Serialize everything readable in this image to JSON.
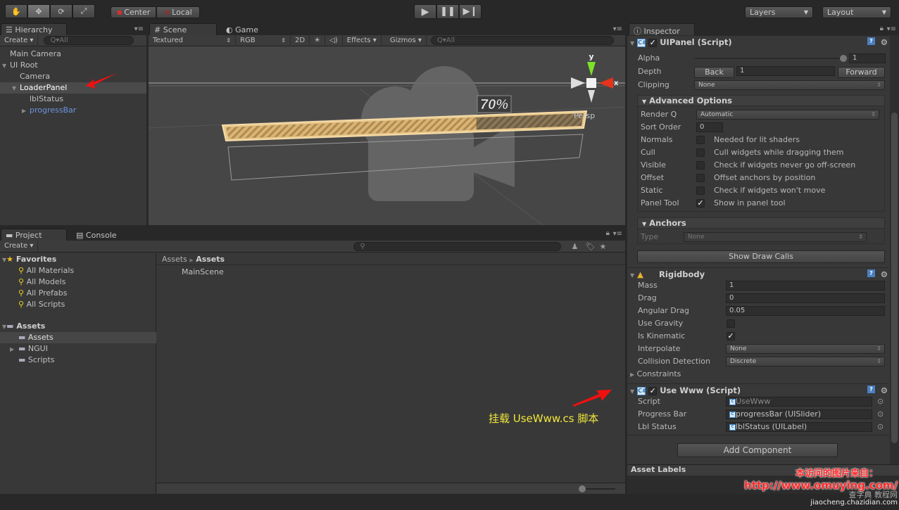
{
  "toolbar": {
    "transform_tools": [
      "hand-icon",
      "move-icon",
      "rotate-icon",
      "scale-icon"
    ],
    "pivot_label": "Center",
    "space_label": "Local",
    "play_icons": [
      "play-icon",
      "pause-icon",
      "step-icon"
    ],
    "layers_label": "Layers",
    "layout_label": "Layout"
  },
  "hierarchy": {
    "tab_label": "Hierarchy",
    "create_label": "Create",
    "search_placeholder": "Q▾All",
    "items": [
      {
        "label": "Main Camera",
        "depth": 0,
        "expander": ""
      },
      {
        "label": "UI Root",
        "depth": 0,
        "expander": "▼"
      },
      {
        "label": "Camera",
        "depth": 1,
        "expander": ""
      },
      {
        "label": "LoaderPanel",
        "depth": 1,
        "expander": "▼",
        "selected": true
      },
      {
        "label": "lblStatus",
        "depth": 2,
        "expander": ""
      },
      {
        "label": "progressBar",
        "depth": 2,
        "expander": "▶",
        "prefab": true
      }
    ]
  },
  "scene": {
    "tab_scene": "Scene",
    "tab_game": "Game",
    "render_mode": "Textured",
    "channel": "RGB",
    "mode_2d": "2D",
    "effects_label": "Effects",
    "gizmos_label": "Gizmos",
    "search_placeholder": "Q▾All",
    "progress_label": "70%",
    "progress_value": 0.7,
    "gizmo_y": "y",
    "gizmo_x": "x",
    "persp_label": "Persp"
  },
  "project": {
    "tab_project": "Project",
    "tab_console": "Console",
    "create_label": "Create",
    "favorites_label": "Favorites",
    "favorites": [
      "All Materials",
      "All Models",
      "All Prefabs",
      "All Scripts"
    ],
    "assets_label": "Assets",
    "asset_folders": [
      {
        "label": "Assets",
        "selected": true,
        "expander": ""
      },
      {
        "label": "NGUI",
        "selected": false,
        "expander": "▶"
      },
      {
        "label": "Scripts",
        "selected": false,
        "expander": ""
      }
    ],
    "breadcrumb_root": "Assets",
    "breadcrumb_current": "Assets",
    "files": [
      "MainScene"
    ]
  },
  "annotation": {
    "text": "挂载 UseWww.cs 脚本",
    "color": "#f0e63c"
  },
  "inspector": {
    "tab_label": "Inspector",
    "uipanel": {
      "title": "UIPanel (Script)",
      "enabled": true,
      "alpha_label": "Alpha",
      "alpha_value": "1",
      "depth_label": "Depth",
      "back_label": "Back",
      "depth_value": "1",
      "forward_label": "Forward",
      "clipping_label": "Clipping",
      "clipping_value": "None",
      "advanced_title": "Advanced Options",
      "render_q_label": "Render Q",
      "render_q_value": "Automatic",
      "sort_order_label": "Sort Order",
      "sort_order_value": "0",
      "options": [
        {
          "label": "Normals",
          "checked": false,
          "desc": "Needed for lit shaders"
        },
        {
          "label": "Cull",
          "checked": false,
          "desc": "Cull widgets while dragging them"
        },
        {
          "label": "Visible",
          "checked": false,
          "desc": "Check if widgets never go off-screen"
        },
        {
          "label": "Offset",
          "checked": false,
          "desc": "Offset anchors by position"
        },
        {
          "label": "Static",
          "checked": false,
          "desc": "Check if widgets won't move"
        },
        {
          "label": "Panel Tool",
          "checked": true,
          "desc": "Show in panel tool"
        }
      ],
      "anchors_title": "Anchors",
      "anchor_type_label": "Type",
      "anchor_type_value": "None",
      "show_draw_calls_label": "Show Draw Calls"
    },
    "rigidbody": {
      "title": "Rigidbody",
      "mass_label": "Mass",
      "mass_value": "1",
      "drag_label": "Drag",
      "drag_value": "0",
      "angular_drag_label": "Angular Drag",
      "angular_drag_value": "0.05",
      "use_gravity_label": "Use Gravity",
      "use_gravity": false,
      "is_kinematic_label": "Is Kinematic",
      "is_kinematic": true,
      "interpolate_label": "Interpolate",
      "interpolate_value": "None",
      "collision_label": "Collision Detection",
      "collision_value": "Discrete",
      "constraints_label": "Constraints"
    },
    "usewww": {
      "title": "Use Www (Script)",
      "enabled": true,
      "script_label": "Script",
      "script_value": "UseWww",
      "progress_bar_label": "Progress Bar",
      "progress_bar_value": "progressBar (UISlider)",
      "lbl_status_label": "Lbl Status",
      "lbl_status_value": "lblStatus (UILabel)"
    },
    "add_component_label": "Add Component",
    "asset_labels_title": "Asset Labels"
  },
  "watermark": {
    "line1": "本访问的图片来自：",
    "url": "http://www.omuying.com/",
    "site": "查字典 教程网",
    "site_url": "jiaocheng.chazidian.com"
  }
}
